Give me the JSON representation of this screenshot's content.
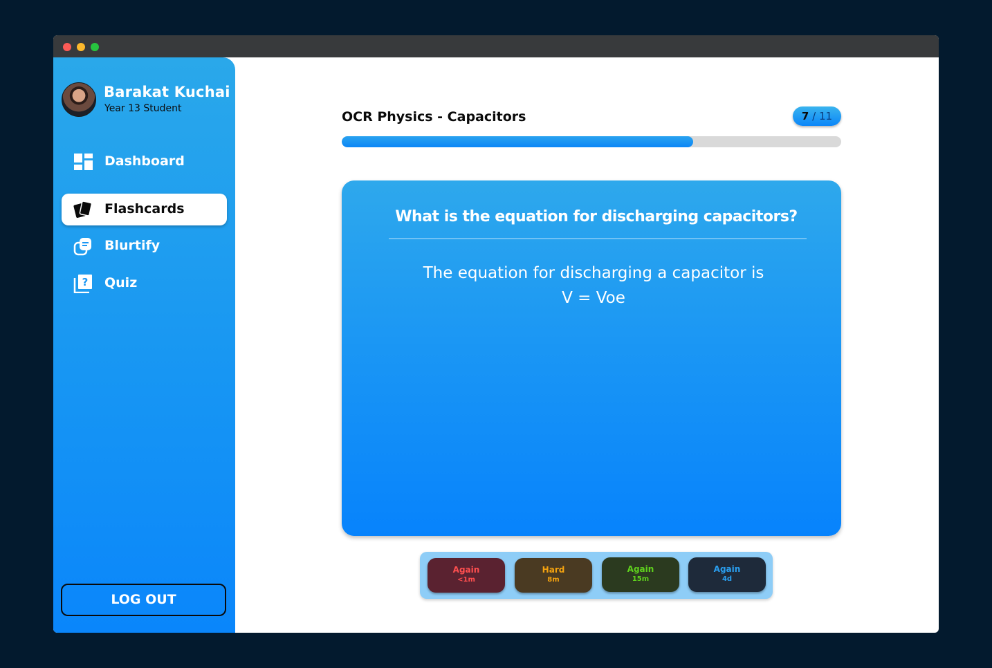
{
  "user": {
    "name": "Barakat Kuchai",
    "role": "Year 13 Student"
  },
  "nav": [
    {
      "label": "Dashboard",
      "icon": "dashboard-icon",
      "active": false
    },
    {
      "label": "Flashcards",
      "icon": "flashcards-icon",
      "active": true
    },
    {
      "label": "Blurtify",
      "icon": "blurtify-icon",
      "active": false
    },
    {
      "label": "Quiz",
      "icon": "quiz-icon",
      "active": false
    }
  ],
  "logout_label": "LOG OUT",
  "deck": {
    "title": "OCR Physics - Capacitors",
    "current": "7",
    "separator": "/",
    "total": "11",
    "progress": 0.703
  },
  "card": {
    "question": "What is the equation for discharging capacitors?",
    "answer_line1": "The equation for discharging a capacitor is",
    "answer_line2": "V = Voe"
  },
  "ratings": [
    {
      "label": "Again",
      "time": "<1m",
      "color": "#ff4f4f",
      "bg": "#5a2230"
    },
    {
      "label": "Hard",
      "time": "8m",
      "color": "#f5a30f",
      "bg": "#4a3a22"
    },
    {
      "label": "Again",
      "time": "15m",
      "color": "#5fd21d",
      "bg": "#2b3a1f"
    },
    {
      "label": "Again",
      "time": "4d",
      "color": "#2a9ff0",
      "bg": "#1e2a3a"
    }
  ],
  "colors": {
    "accent": "#0a86fb",
    "background": "#031a2e"
  }
}
